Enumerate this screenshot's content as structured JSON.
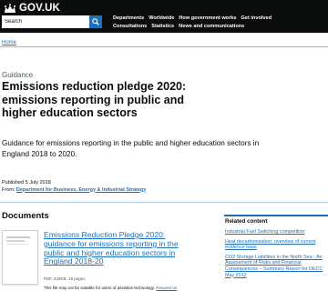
{
  "header": {
    "logo_text": "GOV.UK",
    "search_placeholder": "Search",
    "nav_row1": [
      "Departments",
      "Worldwide",
      "How government works",
      "Get involved"
    ],
    "nav_row2": [
      "Consultations",
      "Statistics",
      "News and communications"
    ]
  },
  "breadcrumb": "Home",
  "doc_type": "Guidance",
  "title": "Emissions reduction pledge 2020: emissions reporting in public and higher education sectors",
  "lede": "Guidance for emissions reporting in the public and higher education sectors in England 2018 to 2020.",
  "meta": {
    "published": "Published 5 July 2018",
    "from_label": "From:",
    "department": "Department for Business, Energy & Industrial Strategy"
  },
  "documents": {
    "heading": "Documents",
    "attachment_title": "Emissions Reduction Pledge 2020: guidance for emissions reporting in the public and higher education sectors in England 2018-20",
    "attachment_meta": "PDF, 426KB, 19 pages",
    "attachment_note": "This file may not be suitable for users of assistive technology.",
    "attachment_request": "Request an"
  },
  "related": {
    "heading": "Related content",
    "items": [
      "Industrial Fuel Switching competition",
      "Heat decarbonisation: overview of current evidence base",
      "CO2 Storage Liabilities in the North Sea - An Assessment of Risks and Financial Consequences – Summary Report for DECC May 2012"
    ]
  },
  "colors": {
    "header_bg": "#0b0c0c",
    "link": "#1d70b8",
    "text": "#0b0c0c"
  }
}
